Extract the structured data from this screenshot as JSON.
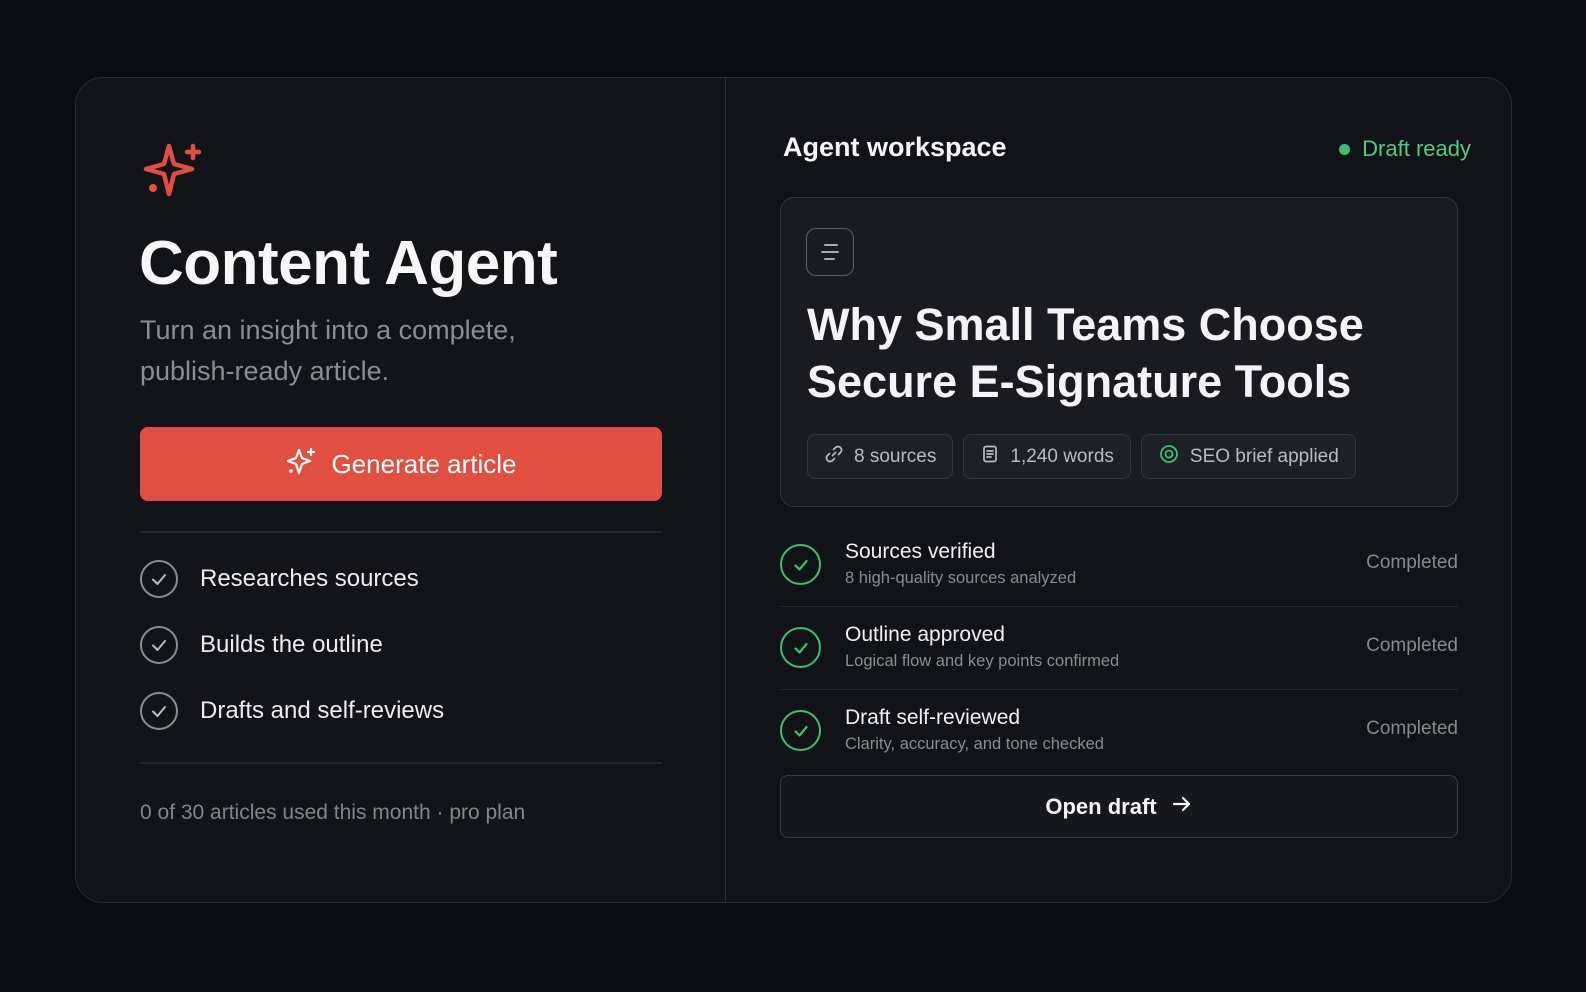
{
  "colors": {
    "accent": "#e14f43",
    "success": "#3fbf72",
    "background": "#0c0d10",
    "card": "#131418"
  },
  "left": {
    "logo_icon": "sparkle-icon",
    "title": "Content Agent",
    "subtitle": "Turn an insight into a complete, publish-ready article.",
    "generate_button": {
      "icon": "sparkle-icon",
      "label": "Generate article"
    },
    "features": [
      {
        "icon": "check-circle-icon",
        "label": "Researches sources"
      },
      {
        "icon": "check-circle-icon",
        "label": "Builds the outline"
      },
      {
        "icon": "check-circle-icon",
        "label": "Drafts and self-reviews"
      }
    ],
    "usage": "0 of 30 articles used this month · pro plan"
  },
  "right": {
    "title": "Agent workspace",
    "status": "Draft ready",
    "article": {
      "icon": "document-icon",
      "title": "Why Small Teams Choose Secure E-Signature Tools",
      "chips": [
        {
          "icon": "link-icon",
          "label": "8 sources"
        },
        {
          "icon": "document-icon",
          "label": "1,240 words"
        },
        {
          "icon": "target-icon",
          "label": "SEO brief applied"
        }
      ]
    },
    "steps": [
      {
        "title": "Sources verified",
        "desc": "8 high-quality sources analyzed",
        "status": "Completed"
      },
      {
        "title": "Outline approved",
        "desc": "Logical flow and key points confirmed",
        "status": "Completed"
      },
      {
        "title": "Draft self-reviewed",
        "desc": "Clarity, accuracy, and tone checked",
        "status": "Completed"
      }
    ],
    "open_button": {
      "label": "Open draft",
      "icon": "arrow-right-icon"
    }
  }
}
